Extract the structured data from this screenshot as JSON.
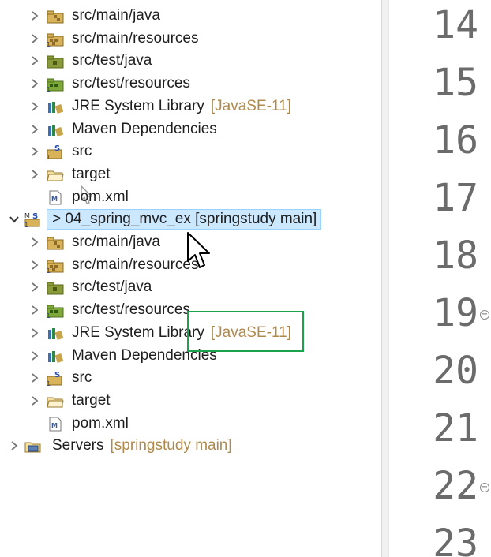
{
  "tree": {
    "rows": [
      {
        "label": "src/main/java",
        "deco": "",
        "icon": "java-package-folder-icon",
        "hasChevron": true
      },
      {
        "label": "src/main/resources",
        "deco": "",
        "icon": "resource-folder-icon",
        "hasChevron": true
      },
      {
        "label": "src/test/java",
        "deco": "",
        "icon": "test-java-folder-icon",
        "hasChevron": true
      },
      {
        "label": "src/test/resources",
        "deco": "",
        "icon": "test-resource-folder-icon",
        "hasChevron": true
      },
      {
        "label": "JRE System Library",
        "deco": "[JavaSE-11]",
        "icon": "library-icon",
        "hasChevron": true
      },
      {
        "label": "Maven Dependencies",
        "deco": "",
        "icon": "library-icon",
        "hasChevron": true
      },
      {
        "label": "src",
        "deco": "",
        "icon": "source-folder-icon",
        "hasChevron": true
      },
      {
        "label": "target",
        "deco": "",
        "icon": "folder-icon",
        "hasChevron": true
      },
      {
        "label": "pom.xml",
        "deco": "",
        "icon": "xml-file-icon",
        "hasChevron": false
      },
      {
        "label": "> 04_spring_mvc_ex [springstudy main]",
        "deco": "",
        "icon": "maven-project-icon",
        "hasChevron": true,
        "expanded": true,
        "selected": true
      },
      {
        "label": "src/main/java",
        "deco": "",
        "icon": "java-package-folder-icon",
        "hasChevron": true
      },
      {
        "label": "src/main/resources",
        "deco": "",
        "icon": "resource-folder-icon",
        "hasChevron": true
      },
      {
        "label": "src/test/java",
        "deco": "",
        "icon": "test-java-folder-icon",
        "hasChevron": true
      },
      {
        "label": "src/test/resources",
        "deco": "",
        "icon": "test-resource-folder-icon",
        "hasChevron": true
      },
      {
        "label": "JRE System Library",
        "deco": "[JavaSE-11]",
        "icon": "library-icon",
        "hasChevron": true
      },
      {
        "label": "Maven Dependencies",
        "deco": "",
        "icon": "library-icon",
        "hasChevron": true
      },
      {
        "label": "src",
        "deco": "",
        "icon": "source-folder-icon",
        "hasChevron": true
      },
      {
        "label": "target",
        "deco": "",
        "icon": "folder-icon",
        "hasChevron": true
      },
      {
        "label": "pom.xml",
        "deco": "",
        "icon": "xml-file-icon",
        "hasChevron": false
      },
      {
        "label": "Servers",
        "deco": "[springstudy main]",
        "icon": "servers-folder-icon",
        "hasChevron": true
      }
    ]
  },
  "editor": {
    "line_numbers": [
      "14",
      "15",
      "16",
      "17",
      "18",
      "19",
      "20",
      "21",
      "22",
      "23"
    ],
    "fold_markers": [
      "19",
      "22"
    ]
  },
  "colors": {
    "selection": "#cce8ff",
    "decoration": "#b08a4c",
    "highlight_box": "#1aa34a"
  }
}
